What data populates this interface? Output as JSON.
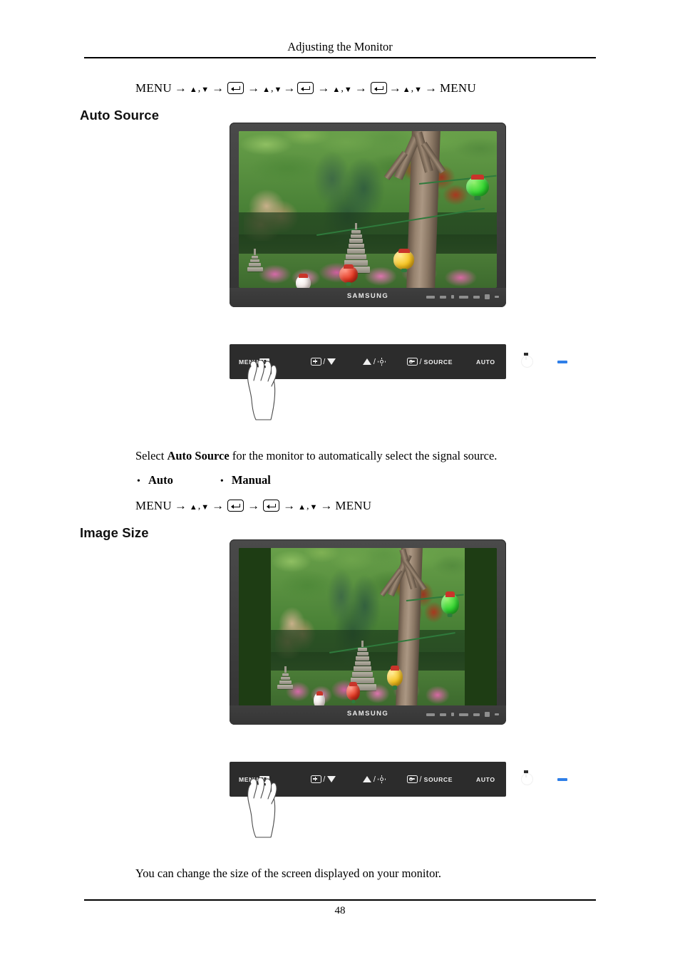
{
  "header": {
    "title": "Adjusting the Monitor"
  },
  "footer": {
    "page_number": "48"
  },
  "nav_sequence_top": {
    "start_label": "MENU",
    "end_label": "MENU",
    "up_arrow": "▲",
    "down_arrow": "▼",
    "separator": ",",
    "arrow": "→",
    "enter_icon": "enter-key-icon"
  },
  "sections": [
    {
      "id": "auto-source",
      "heading": "Auto Source",
      "description_prefix": "Select ",
      "description_bold": "Auto Source",
      "description_suffix": " for the monitor to automatically select the signal source.",
      "options": [
        {
          "bullet": "•",
          "label": "Auto"
        },
        {
          "bullet": "•",
          "label": "Manual"
        }
      ],
      "nav_sequence": {
        "start_label": "MENU",
        "end_label": "MENU"
      }
    },
    {
      "id": "image-size",
      "heading": "Image Size",
      "description": "You can change the size of the screen displayed on your monitor."
    }
  ],
  "monitor": {
    "brand": "SAMSUNG",
    "bezel_color": "#3d3d3d",
    "screen_bg": "#000000"
  },
  "control_panel": {
    "background_color": "#2c2c2c",
    "led_color": "#2f7fe8",
    "buttons": [
      {
        "name": "menu-button",
        "label": "MENU",
        "icon": "menu-grid-icon"
      },
      {
        "name": "down-adjust-button",
        "label": "",
        "icon": "plus-box-slash-down-arrow-icon"
      },
      {
        "name": "up-brightness-button",
        "label": "",
        "icon": "up-arrow-slash-brightness-icon"
      },
      {
        "name": "source-button",
        "label": "SOURCE",
        "icon": "input-box-slash-source-icon"
      },
      {
        "name": "auto-button",
        "label": "AUTO",
        "icon": ""
      },
      {
        "name": "power-button",
        "label": "",
        "icon": "power-icon"
      },
      {
        "name": "power-led",
        "label": "",
        "icon": "led-indicator"
      }
    ]
  }
}
